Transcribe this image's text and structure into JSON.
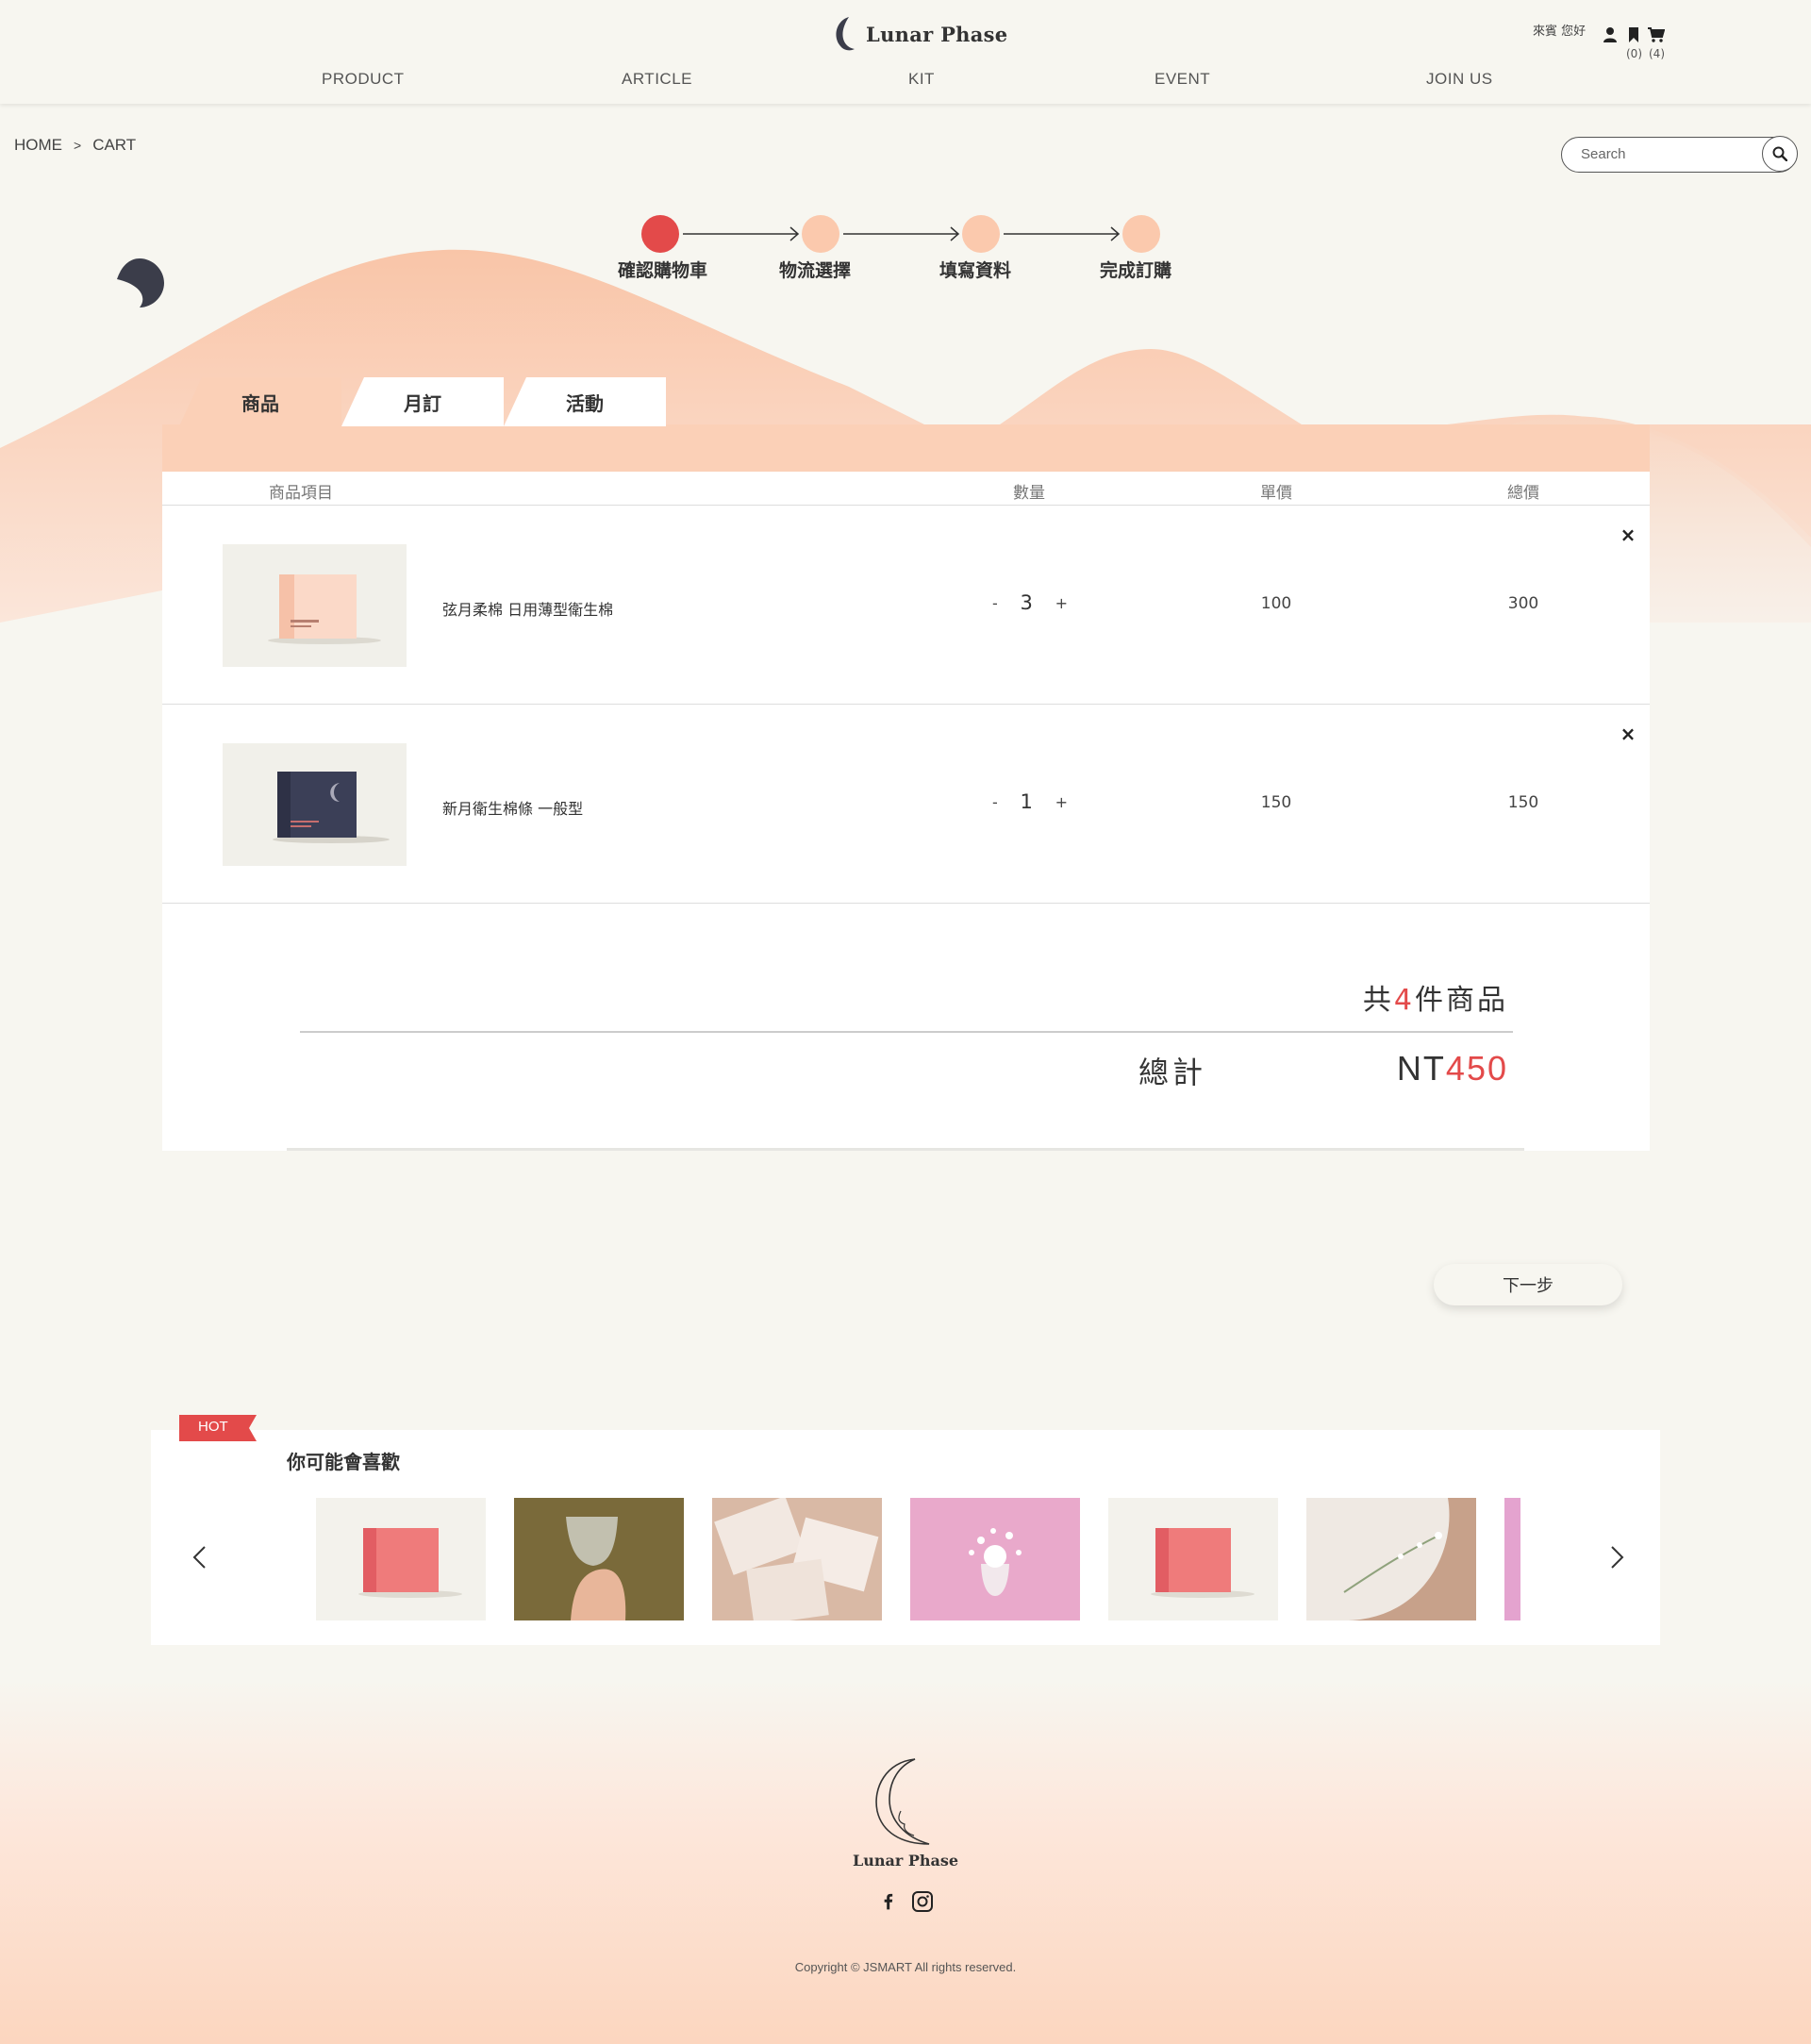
{
  "brand": {
    "name": "Lunar Phase"
  },
  "nav": {
    "product": "PRODUCT",
    "article": "ARTICLE",
    "kit": "KIT",
    "event": "EVENT",
    "join": "JOIN US"
  },
  "user": {
    "greeting": "來賓 您好",
    "bookmark_count": "(0)",
    "cart_count": "(4)"
  },
  "breadcrumb": {
    "home": "HOME",
    "separator": ">",
    "current": "CART"
  },
  "search": {
    "placeholder": "Search"
  },
  "steps": [
    {
      "label": "確認購物車",
      "status": "active"
    },
    {
      "label": "物流選擇",
      "status": "pending"
    },
    {
      "label": "填寫資料",
      "status": "pending"
    },
    {
      "label": "完成訂購",
      "status": "pending"
    }
  ],
  "tabs": [
    {
      "label": "商品",
      "selected": true
    },
    {
      "label": "月訂",
      "selected": false
    },
    {
      "label": "活動",
      "selected": false
    }
  ],
  "cart": {
    "headers": {
      "item": "商品項目",
      "qty": "數量",
      "unit": "單價",
      "total": "總價"
    },
    "items": [
      {
        "name": "弦月柔棉 日用薄型衛生棉",
        "qty": "3",
        "unit_price": "100",
        "total": "300",
        "minus": "-",
        "plus": "+",
        "remove": "×",
        "box_color": "#f8cdb8"
      },
      {
        "name": "新月衛生棉條 一般型",
        "qty": "1",
        "unit_price": "150",
        "total": "150",
        "minus": "-",
        "plus": "+",
        "remove": "×",
        "box_color": "#3b3f57"
      }
    ],
    "summary": {
      "prefix": "共",
      "count": "4",
      "suffix": "件商品",
      "total_label": "總計",
      "currency": "NT",
      "total": "450"
    }
  },
  "next_button": "下一步",
  "recommend": {
    "badge": "HOT",
    "title": "你可能會喜歡",
    "items": [
      "pink-product-box",
      "menstrual-cup-in-hand",
      "wrapped-pads",
      "cup-with-flowers",
      "pink-product-box",
      "pad-with-flowers",
      "pink-product"
    ]
  },
  "footer": {
    "name": "Lunar Phase",
    "copyright": "Copyright © JSMART All rights reserved."
  },
  "colors": {
    "accent": "#e34a4a",
    "peach": "#fbd0b7",
    "background": "#f7f6f0",
    "dark": "#3b3d4a"
  }
}
